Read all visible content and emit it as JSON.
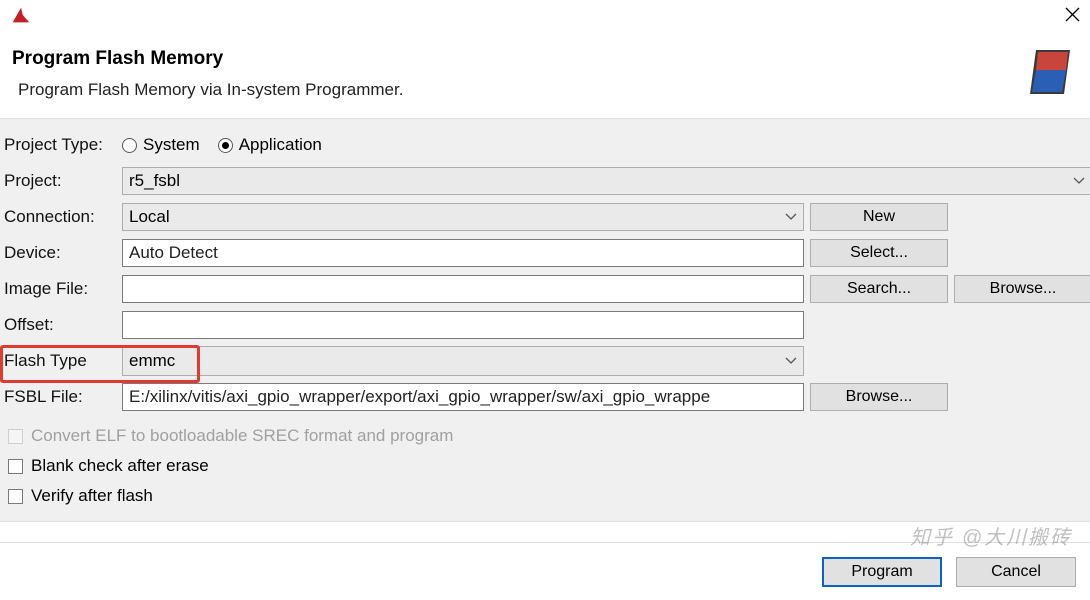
{
  "window": {
    "close_aria": "Close"
  },
  "header": {
    "title": "Program Flash Memory",
    "subtitle": "Program Flash Memory via In-system Programmer."
  },
  "form": {
    "project_type_label": "Project Type:",
    "project_type": {
      "system_label": "System",
      "application_label": "Application",
      "selected": "application"
    },
    "project_label": "Project:",
    "project_value": "r5_fsbl",
    "connection_label": "Connection:",
    "connection_value": "Local",
    "device_label": "Device:",
    "device_value": "Auto Detect",
    "image_file_label": "Image File:",
    "image_file_value": "",
    "offset_label": "Offset:",
    "offset_value": "",
    "flash_type_label": "Flash Type",
    "flash_type_value": "emmc",
    "fsbl_file_label": "FSBL File:",
    "fsbl_file_value": "E:/xilinx/vitis/axi_gpio_wrapper/export/axi_gpio_wrapper/sw/axi_gpio_wrappe"
  },
  "buttons": {
    "new": "New",
    "select": "Select...",
    "search": "Search...",
    "browse": "Browse..."
  },
  "checks": {
    "convert_elf": "Convert ELF to bootloadable SREC format and program",
    "blank_check": "Blank check after erase",
    "verify": "Verify after flash"
  },
  "footer": {
    "program": "Program",
    "cancel": "Cancel"
  },
  "watermark": "知乎 @大川搬砖"
}
